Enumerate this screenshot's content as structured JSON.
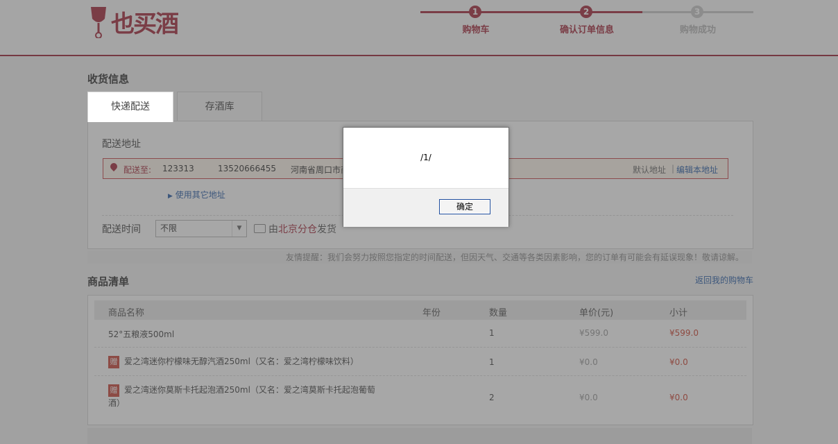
{
  "header": {
    "logo_text": "也买酒",
    "steps": [
      {
        "num": "1",
        "label": "购物车",
        "state": "done"
      },
      {
        "num": "2",
        "label": "确认订单信息",
        "state": "done"
      },
      {
        "num": "3",
        "label": "购物成功",
        "state": "todo"
      }
    ]
  },
  "shipping": {
    "section_title": "收货信息",
    "tabs": [
      {
        "label": "快递配送",
        "active": true
      },
      {
        "label": "存酒库",
        "active": false
      }
    ],
    "address_title": "配送地址",
    "address": {
      "prefix": "配送至:",
      "name": "123313",
      "phone": "13520666455",
      "region": "河南省周口市商",
      "default_label": "默认地址",
      "separator": "|",
      "edit_link": "编辑本地址"
    },
    "other_address_link": "使用其它地址",
    "time_label": "配送时间",
    "time_select_value": "不限",
    "ship_from_prefix": "由",
    "ship_from_branch": "北京分仓",
    "ship_from_suffix": "发货",
    "tip": "友情提醒：我们会努力按照您指定的时间配送，但因天气、交通等各类因素影响，您的订单有可能会有延误现象！敬请谅解。"
  },
  "goods": {
    "section_title": "商品清单",
    "back_link": "返回我的购物车",
    "columns": [
      "商品名称",
      "年份",
      "数量",
      "单价(元)",
      "小计"
    ],
    "gift_badge": "赠",
    "rows": [
      {
        "name": "52°五粮液500ml",
        "year": "",
        "qty": "1",
        "price": "¥599.0",
        "subtotal": "¥599.0",
        "gift": false
      },
      {
        "name": "爱之湾迷你柠檬味无醇汽酒250ml（又名：爱之湾柠檬味饮料）",
        "year": "",
        "qty": "1",
        "price": "¥0.0",
        "subtotal": "¥0.0",
        "gift": true
      },
      {
        "name_line1": "爱之湾迷你莫斯卡托起泡酒250ml（又名：爱之湾莫斯卡托起泡葡萄",
        "name_line2": "酒）",
        "year": "",
        "qty": "2",
        "price": "¥0.0",
        "subtotal": "¥0.0",
        "gift": true
      }
    ]
  },
  "dialog": {
    "message": "/1/",
    "ok_label": "确定"
  },
  "colors": {
    "brand": "#a52a3c",
    "link": "#2a5ea8",
    "price_red": "#cc4433"
  }
}
